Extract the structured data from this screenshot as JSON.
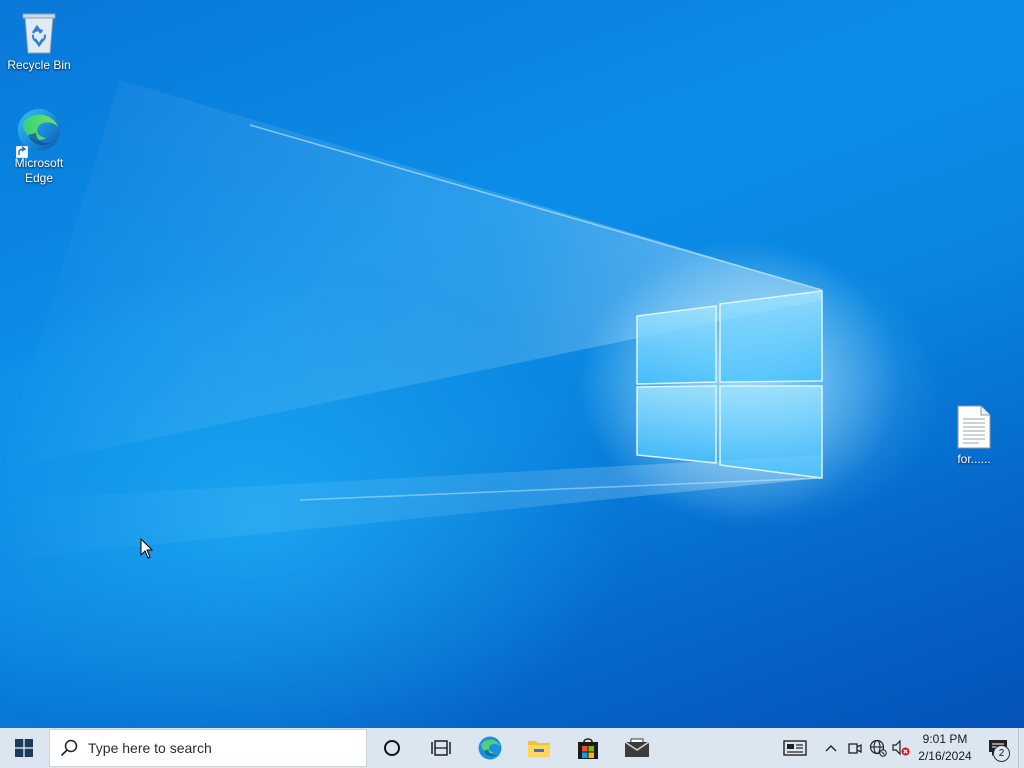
{
  "desktop": {
    "icons": [
      {
        "label": "Recycle Bin",
        "icon": "recycle-bin-icon"
      },
      {
        "label": "Microsoft\nEdge",
        "icon": "edge-icon"
      },
      {
        "label": "for......",
        "icon": "text-document-icon"
      }
    ]
  },
  "taskbar": {
    "search_placeholder": "Type here to search",
    "pinned_apps": [
      "cortana-icon",
      "task-view-icon",
      "edge-icon",
      "file-explorer-icon",
      "microsoft-store-icon",
      "mail-icon"
    ],
    "clock": {
      "time": "9:01 PM",
      "date": "2/16/2024"
    },
    "notification_count": "2"
  },
  "colors": {
    "taskbar_bg": "#dce6f0",
    "desktop_blue": "#0a86e0",
    "start_accent": "#1f3b5c"
  }
}
